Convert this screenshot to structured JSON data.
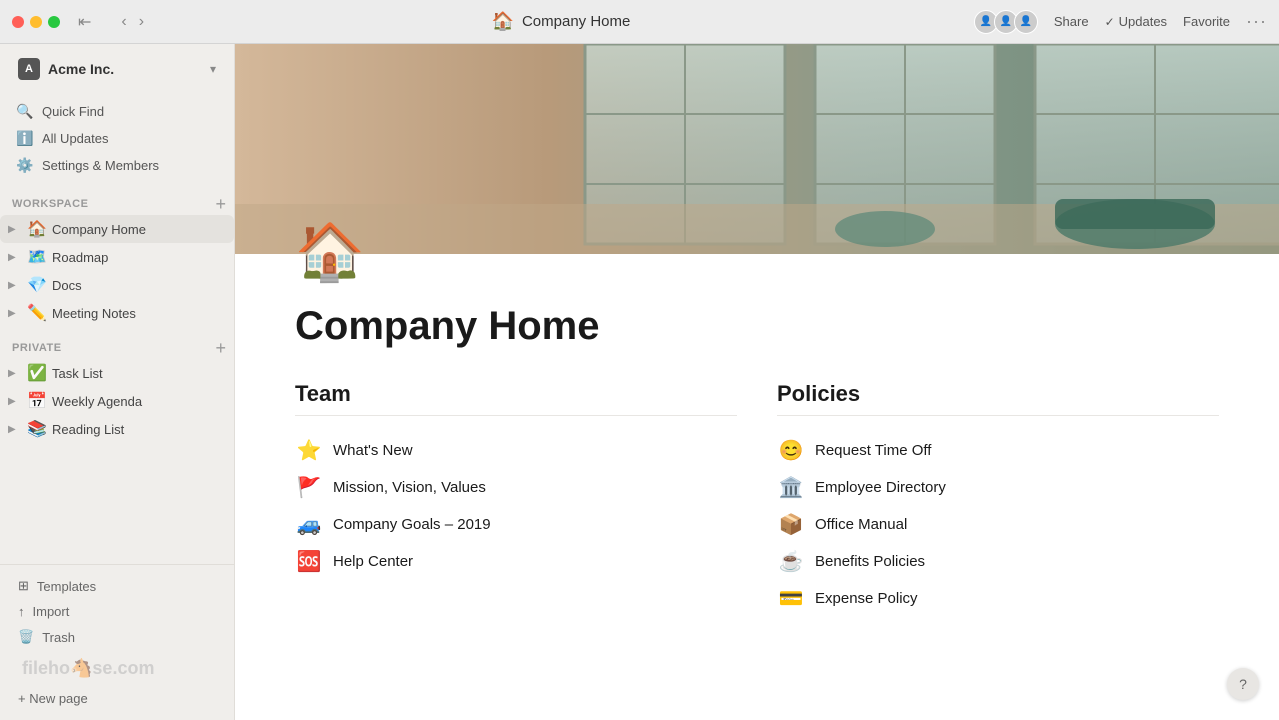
{
  "titlebar": {
    "page_title": "Company Home",
    "share_label": "Share",
    "updates_label": "Updates",
    "favorite_label": "Favorite"
  },
  "sidebar": {
    "workspace_name": "Acme Inc.",
    "nav_items": [
      {
        "id": "quick-find",
        "label": "Quick Find",
        "icon": "🔍"
      },
      {
        "id": "all-updates",
        "label": "All Updates",
        "icon": "ℹ️"
      },
      {
        "id": "settings",
        "label": "Settings & Members",
        "icon": "⚙️"
      }
    ],
    "workspace_section": {
      "label": "WORKSPACE",
      "items": [
        {
          "id": "company-home",
          "label": "Company Home",
          "icon": "🏠",
          "active": true
        },
        {
          "id": "roadmap",
          "label": "Roadmap",
          "icon": "🗺️"
        },
        {
          "id": "docs",
          "label": "Docs",
          "icon": "💎"
        },
        {
          "id": "meeting-notes",
          "label": "Meeting Notes",
          "icon": "✏️"
        }
      ]
    },
    "private_section": {
      "label": "PRIVATE",
      "items": [
        {
          "id": "task-list",
          "label": "Task List",
          "icon": "✅"
        },
        {
          "id": "weekly-agenda",
          "label": "Weekly Agenda",
          "icon": "📅"
        },
        {
          "id": "reading-list",
          "label": "Reading List",
          "icon": "📚"
        }
      ]
    },
    "bottom_items": [
      {
        "id": "templates",
        "label": "Templates",
        "icon": "⊞"
      },
      {
        "id": "import",
        "label": "Import",
        "icon": "↑"
      },
      {
        "id": "trash",
        "label": "Trash",
        "icon": "🗑️"
      }
    ],
    "new_page_label": "+ New page"
  },
  "main": {
    "page_title": "Company Home",
    "page_icon": "🏠",
    "team_section": {
      "title": "Team",
      "links": [
        {
          "id": "whats-new",
          "icon": "⭐",
          "label": "What's New"
        },
        {
          "id": "mission-vision",
          "icon": "🚩",
          "label": "Mission, Vision, Values"
        },
        {
          "id": "company-goals",
          "icon": "🚙",
          "label": "Company Goals – 2019"
        },
        {
          "id": "help-center",
          "icon": "🆘",
          "label": "Help Center"
        }
      ]
    },
    "policies_section": {
      "title": "Policies",
      "links": [
        {
          "id": "request-time-off",
          "icon": "😊",
          "label": "Request Time Off"
        },
        {
          "id": "employee-directory",
          "icon": "🏛️",
          "label": "Employee Directory"
        },
        {
          "id": "office-manual",
          "icon": "📦",
          "label": "Office Manual"
        },
        {
          "id": "benefits-policies",
          "icon": "☕",
          "label": "Benefits Policies"
        },
        {
          "id": "expense-policy",
          "icon": "💳",
          "label": "Expense Policy"
        }
      ]
    }
  },
  "help_button": "?",
  "filehorse_logo": "fileho se.com"
}
